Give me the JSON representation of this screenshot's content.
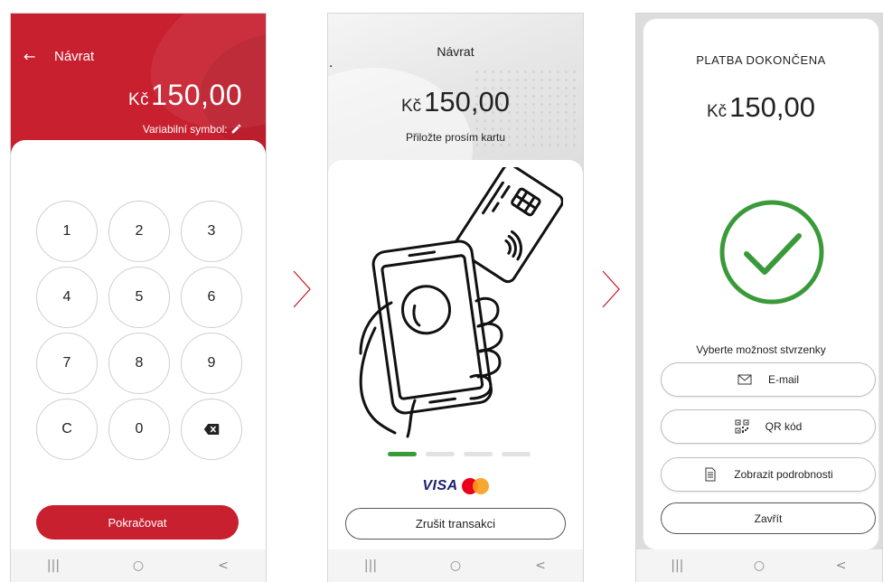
{
  "screen1": {
    "back_label": "Návrat",
    "currency": "Kč",
    "amount": "150,00",
    "variable_symbol_label": "Variabilní symbol:",
    "keys": [
      "1",
      "2",
      "3",
      "4",
      "5",
      "6",
      "7",
      "8",
      "9",
      "C",
      "0",
      ""
    ],
    "continue_label": "Pokračovat"
  },
  "screen2": {
    "dot": ".",
    "back_label": "Návrat",
    "currency": "Kč",
    "amount": "150,00",
    "instruction": "Přiložte prosím kartu",
    "progress_steps": 4,
    "progress_active": 1,
    "brand_visa": "VISA",
    "cancel_label": "Zrušit transakci"
  },
  "screen3": {
    "title": "PLATBA DOKONČENA",
    "currency": "Kč",
    "amount": "150,00",
    "select_label": "Vyberte možnost stvrzenky",
    "email_label": "E-mail",
    "qr_label": "QR kód",
    "details_label": "Zobrazit podrobnosti",
    "close_label": "Zavřít"
  },
  "navbar": {
    "recent": "|||",
    "home": "○",
    "back": "<"
  },
  "colors": {
    "brand_red": "#c8202f",
    "success_green": "#3a9a3a",
    "visa_blue": "#1a1f71",
    "mastercard_red": "#eb001b",
    "mastercard_yellow": "#f79e1b"
  },
  "icons": [
    "arrow-left-icon",
    "pencil-icon",
    "backspace-icon",
    "chevron-right-icon",
    "card-tap-icon",
    "checkmark-icon",
    "mail-icon",
    "qr-code-icon",
    "document-icon"
  ]
}
